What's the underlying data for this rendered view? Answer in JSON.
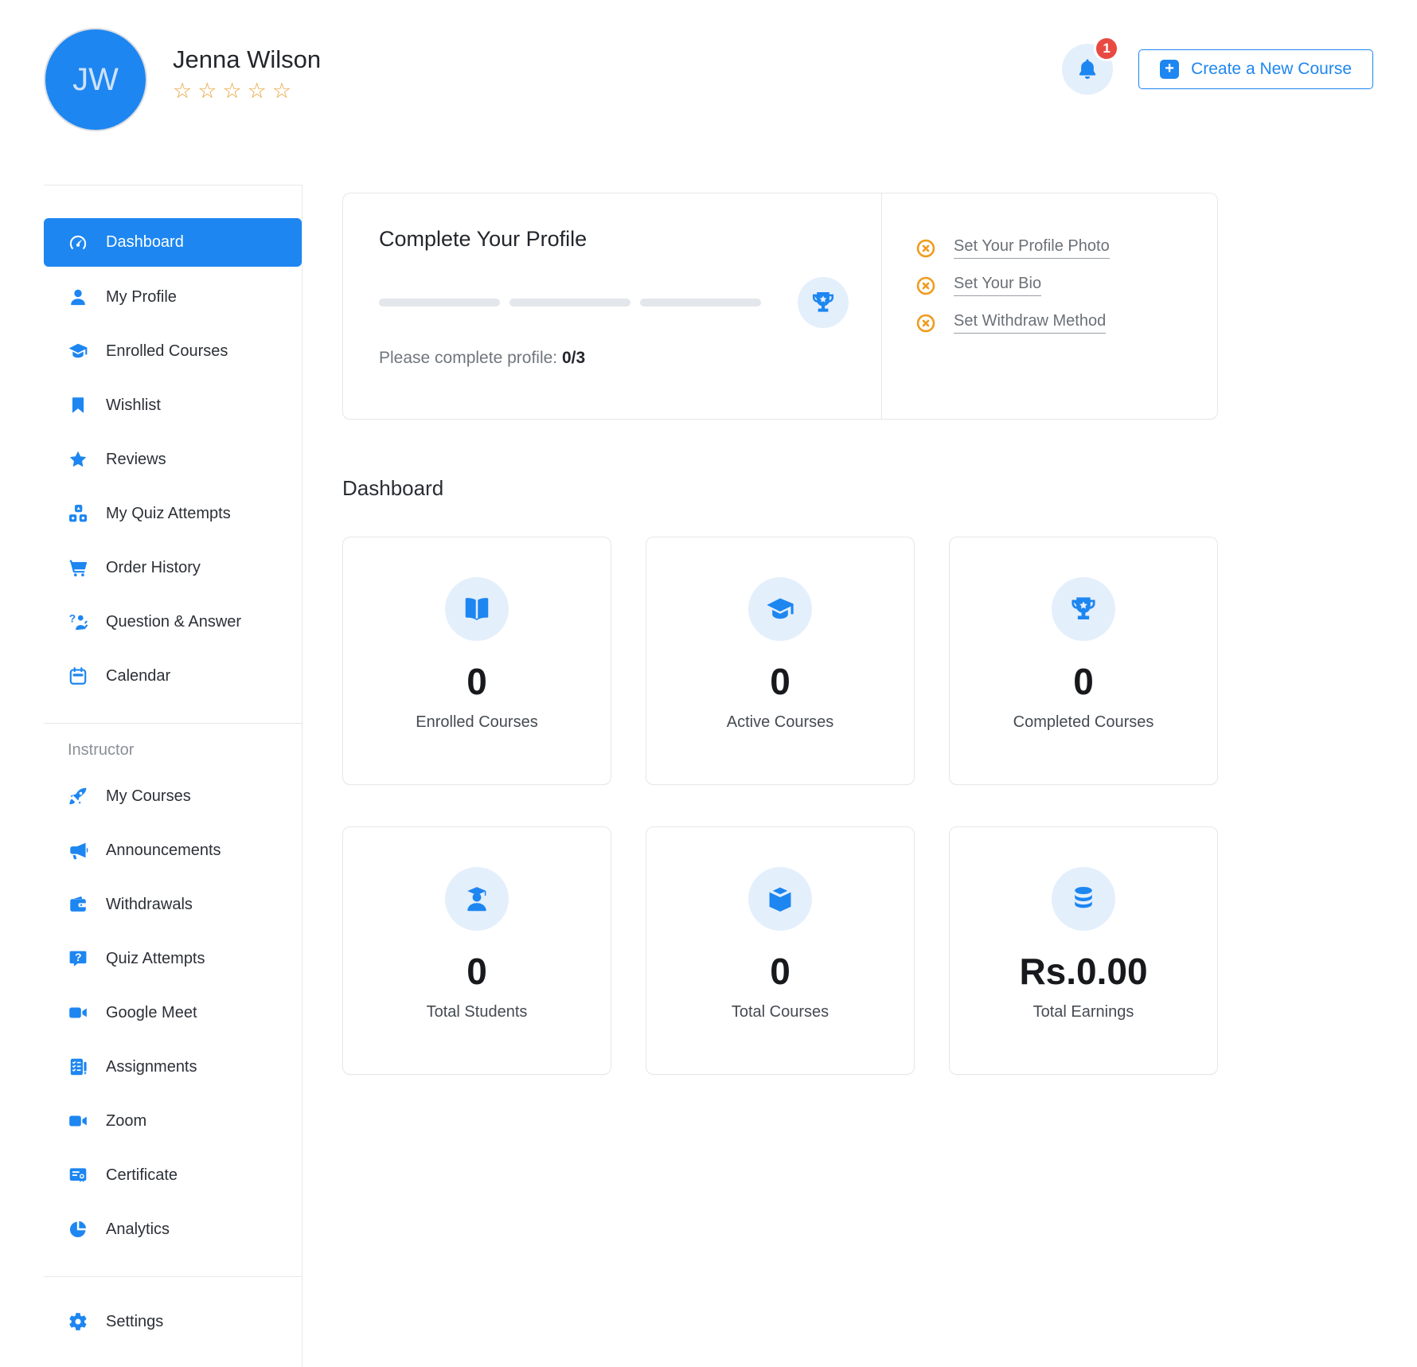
{
  "header": {
    "avatar_initials": "JW",
    "user_name": "Jenna Wilson",
    "rating_stars": 5,
    "notification_count": "1",
    "create_course_label": "Create a New Course"
  },
  "sidebar": {
    "items": [
      {
        "label": "Dashboard",
        "icon": "dashboard-gauge-icon",
        "active": true
      },
      {
        "label": "My Profile",
        "icon": "user-icon"
      },
      {
        "label": "Enrolled Courses",
        "icon": "graduation-cap-icon"
      },
      {
        "label": "Wishlist",
        "icon": "bookmark-icon"
      },
      {
        "label": "Reviews",
        "icon": "star-icon"
      },
      {
        "label": "My Quiz Attempts",
        "icon": "blocks-icon"
      },
      {
        "label": "Order History",
        "icon": "cart-icon"
      },
      {
        "label": "Question & Answer",
        "icon": "question-answer-icon"
      },
      {
        "label": "Calendar",
        "icon": "calendar-icon"
      }
    ],
    "instructor_label": "Instructor",
    "instructor_items": [
      {
        "label": "My Courses",
        "icon": "rocket-icon"
      },
      {
        "label": "Announcements",
        "icon": "megaphone-icon"
      },
      {
        "label": "Withdrawals",
        "icon": "wallet-icon"
      },
      {
        "label": "Quiz Attempts",
        "icon": "question-bubble-icon"
      },
      {
        "label": "Google Meet",
        "icon": "video-camera-icon"
      },
      {
        "label": "Assignments",
        "icon": "assignment-icon"
      },
      {
        "label": "Zoom",
        "icon": "video-camera-icon"
      },
      {
        "label": "Certificate",
        "icon": "certificate-icon"
      },
      {
        "label": "Analytics",
        "icon": "pie-chart-icon"
      }
    ],
    "footer_items": [
      {
        "label": "Settings",
        "icon": "gear-icon"
      }
    ]
  },
  "profile_card": {
    "title": "Complete Your Profile",
    "progress_segments": 3,
    "progress_note": "Please complete profile: ",
    "progress_value": "0/3",
    "checklist": [
      {
        "label": "Set Your Profile Photo",
        "icon": "circle-x-icon"
      },
      {
        "label": "Set Your Bio",
        "icon": "circle-x-icon"
      },
      {
        "label": "Set Withdraw Method",
        "icon": "circle-x-icon"
      }
    ]
  },
  "main": {
    "section_title": "Dashboard",
    "stats": [
      {
        "label": "Enrolled Courses",
        "value": "0",
        "icon": "open-book-icon"
      },
      {
        "label": "Active Courses",
        "value": "0",
        "icon": "graduation-cap-icon"
      },
      {
        "label": "Completed Courses",
        "value": "0",
        "icon": "trophy-icon"
      },
      {
        "label": "Total Students",
        "value": "0",
        "icon": "student-icon"
      },
      {
        "label": "Total Courses",
        "value": "0",
        "icon": "box-icon"
      },
      {
        "label": "Total Earnings",
        "value": "Rs.0.00",
        "icon": "coins-icon"
      }
    ]
  },
  "colors": {
    "primary_blue": "#1d86f1",
    "light_blue_bg": "#e4effc",
    "badge_red": "#e84a42",
    "warning_orange": "#ef9c1f",
    "star_gold": "#e7a439",
    "border_gray": "#e5e7ea"
  }
}
